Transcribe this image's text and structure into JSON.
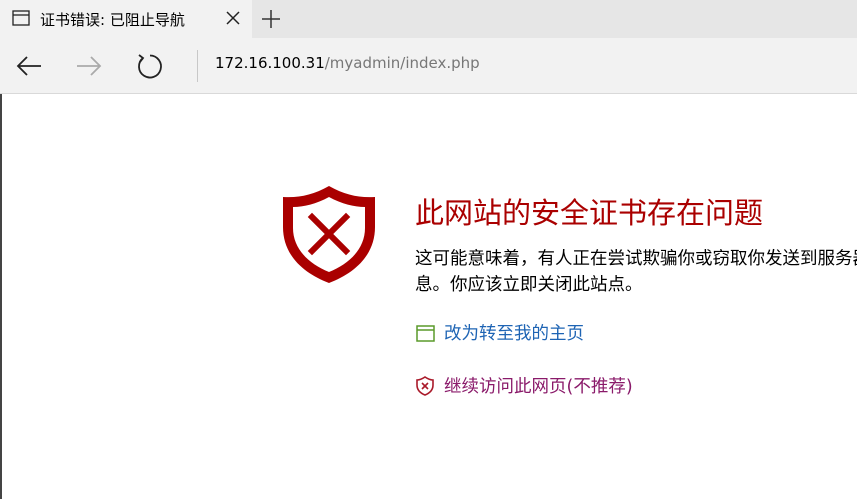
{
  "tab": {
    "title": "证书错误: 已阻止导航",
    "icon": "page-icon",
    "close_icon": "close-icon"
  },
  "toolbar": {
    "new_tab_icon": "plus-icon",
    "back_icon": "back-arrow-icon",
    "forward_icon": "forward-arrow-icon",
    "refresh_icon": "refresh-icon"
  },
  "address": {
    "host": "172.16.100.31",
    "path": "/myadmin/index.php"
  },
  "main": {
    "headline": "此网站的安全证书存在问题",
    "description_line1": "这可能意味着，有人正在尝试欺骗你或窃取你发送到服务器的任何信",
    "description_line2": "息。你应该立即关闭此站点。",
    "home_link": "改为转至我的主页",
    "continue_link": "继续访问此网页(不推荐)"
  },
  "colors": {
    "headline": "#aa0000",
    "shield": "#aa0000",
    "home_link": "#1e64b4",
    "continue_link": "#8a1a6a",
    "home_icon": "#5a9a2a"
  }
}
